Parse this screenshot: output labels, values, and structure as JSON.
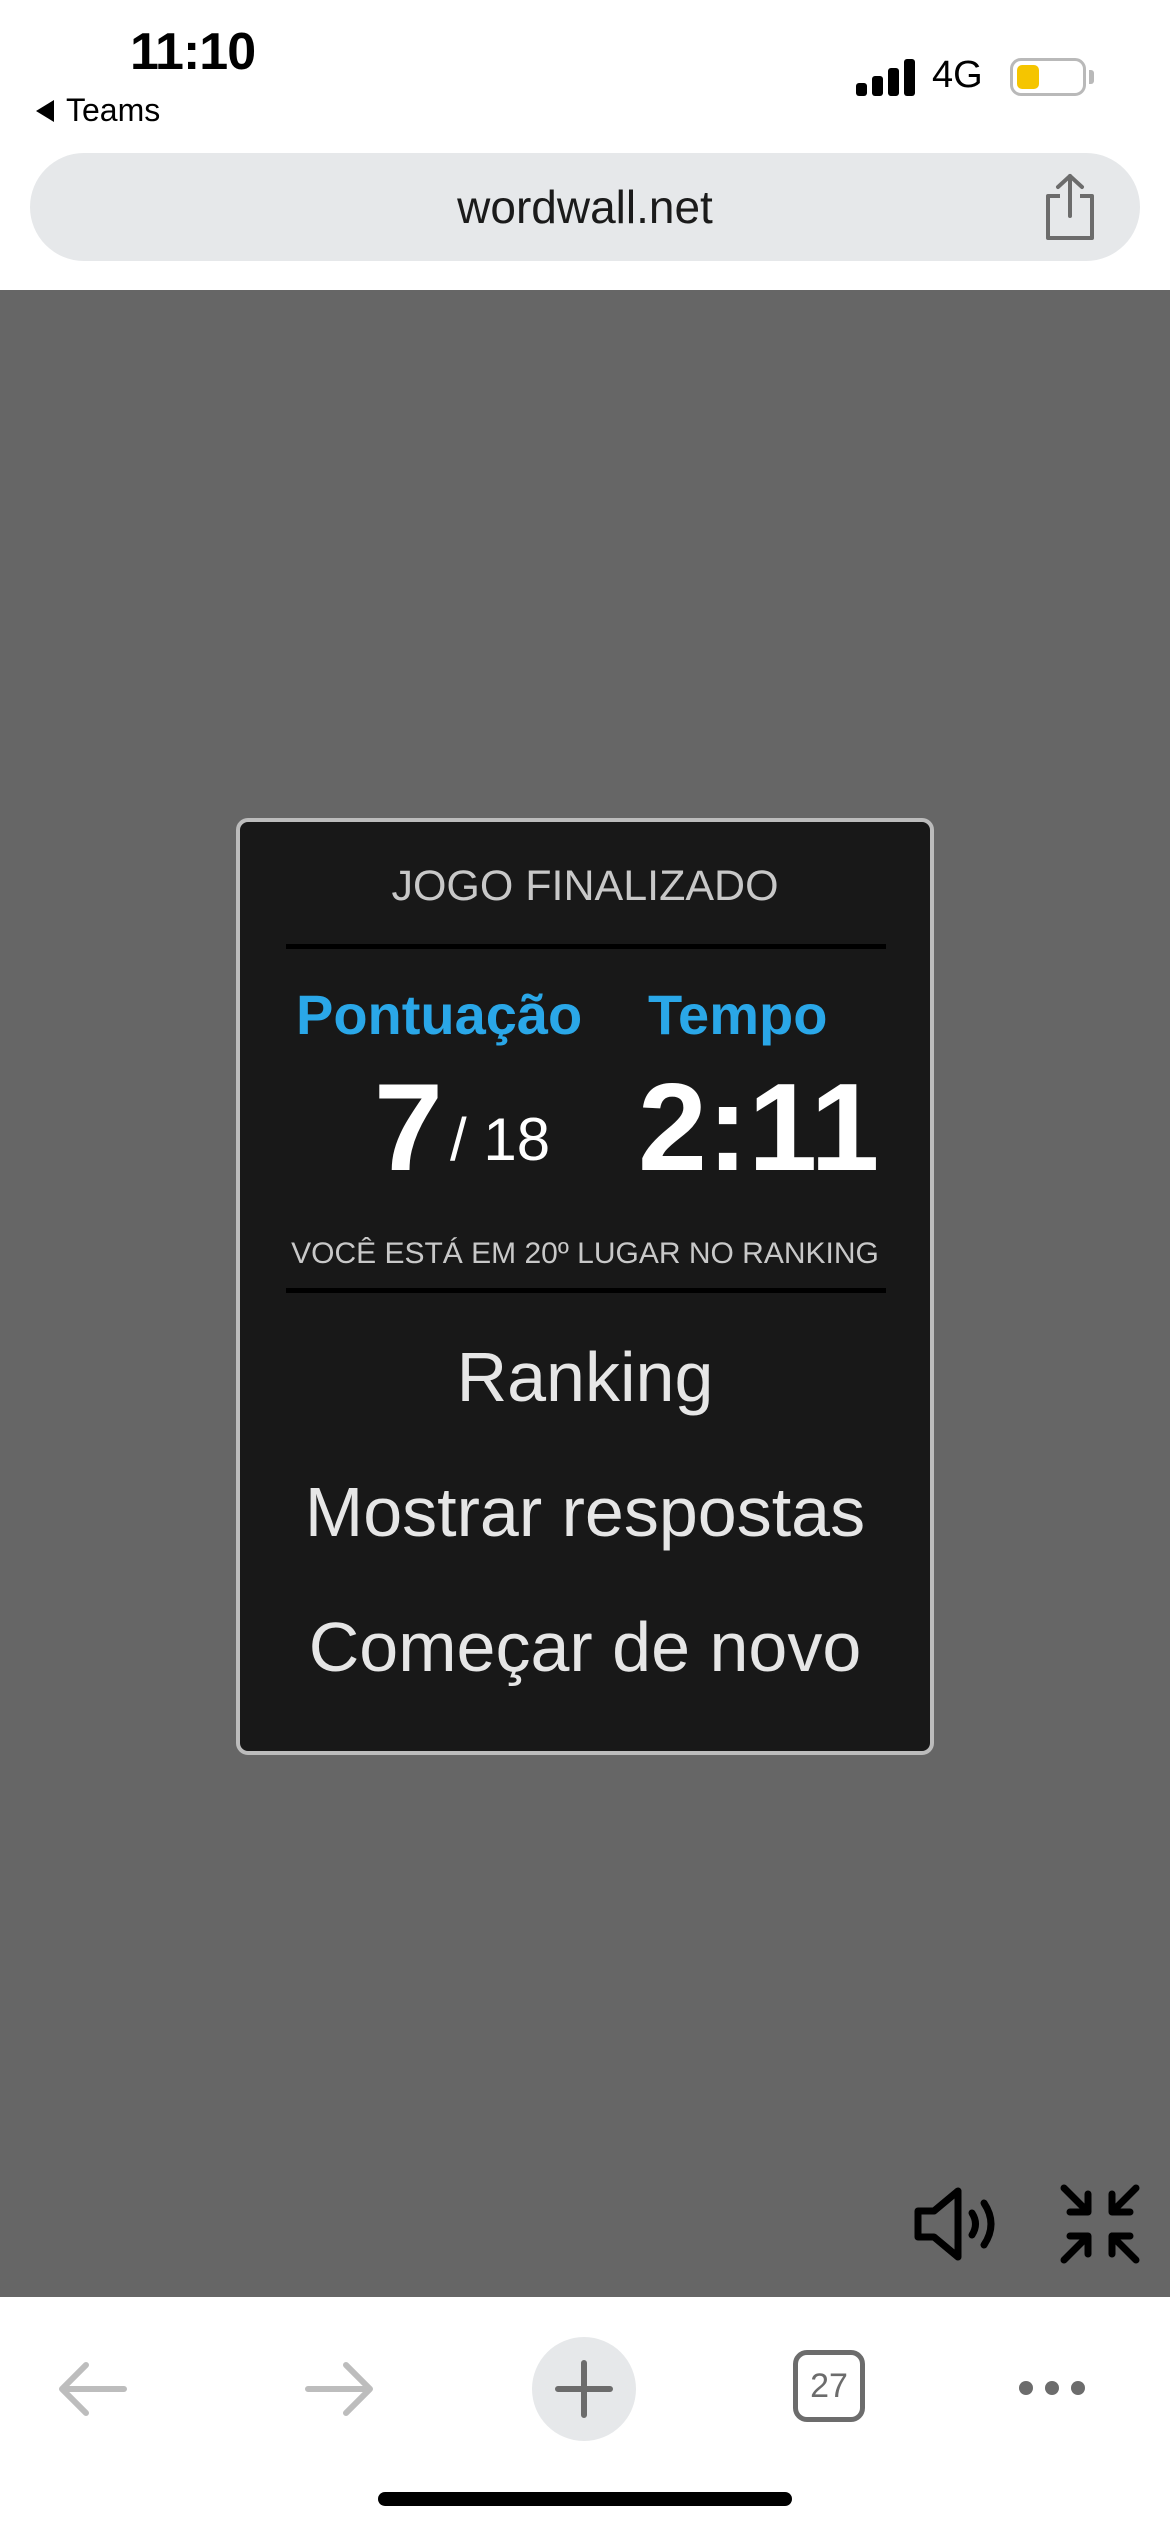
{
  "status_bar": {
    "time": "11:10",
    "back_app": "Teams",
    "network": "4G",
    "battery_color": "#f5c500"
  },
  "url_bar": {
    "url": "wordwall.net"
  },
  "result_panel": {
    "title": "JOGO FINALIZADO",
    "score_label": "Pontuação",
    "time_label": "Tempo",
    "score": "7",
    "score_total": "/ 18",
    "time": "2:11",
    "ranking_note": "VOCÊ ESTÁ EM 20º LUGAR NO RANKING",
    "menu": {
      "ranking": "Ranking",
      "show_answers": "Mostrar respostas",
      "restart": "Começar de novo"
    },
    "accent_color": "#2aa7e8"
  },
  "game_controls": {
    "sound_icon": "speaker-icon",
    "minimize_icon": "exit-fullscreen-icon"
  },
  "toolbar": {
    "tab_count": "27",
    "icons": [
      "back-arrow-icon",
      "forward-arrow-icon",
      "plus-icon",
      "tabs-icon",
      "more-icon"
    ]
  }
}
